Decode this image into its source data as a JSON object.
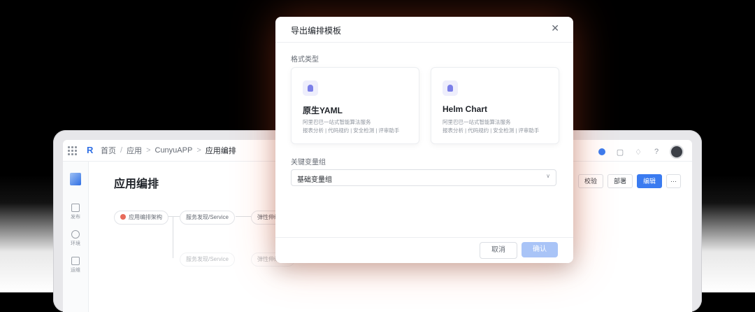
{
  "app": {
    "breadcrumb": [
      "首页",
      "应用",
      "CunyuAPP",
      "应用编排"
    ],
    "page_title": "应用编排",
    "actions": {
      "validate": "校验",
      "deploy": "部署",
      "edit": "编辑",
      "more": "···"
    },
    "rail": [
      {
        "label": "发布"
      },
      {
        "label": "环境"
      },
      {
        "label": "运维"
      }
    ],
    "nodes": {
      "root": "应用编排架构",
      "svc1": "服务发现/Service",
      "ing1": "弹性伸缩/Ing",
      "svc2": "服务发现/Service",
      "ing2": "弹性伸缩/Ing"
    }
  },
  "modal": {
    "title": "导出编排模板",
    "format_label": "格式类型",
    "cards": [
      {
        "title": "原生YAML",
        "line1": "阿里巴巴一站式智能算法服务",
        "line2": "报表分析 | 代码规约 | 安全检测 | 评审助手"
      },
      {
        "title": "Helm Chart",
        "line1": "阿里巴巴一站式智能算法服务",
        "line2": "报表分析 | 代码规约 | 安全检测 | 评审助手"
      }
    ],
    "var_group_label": "关键变量组",
    "var_group_value": "基础变量组",
    "cancel": "取消",
    "confirm": "确认"
  }
}
